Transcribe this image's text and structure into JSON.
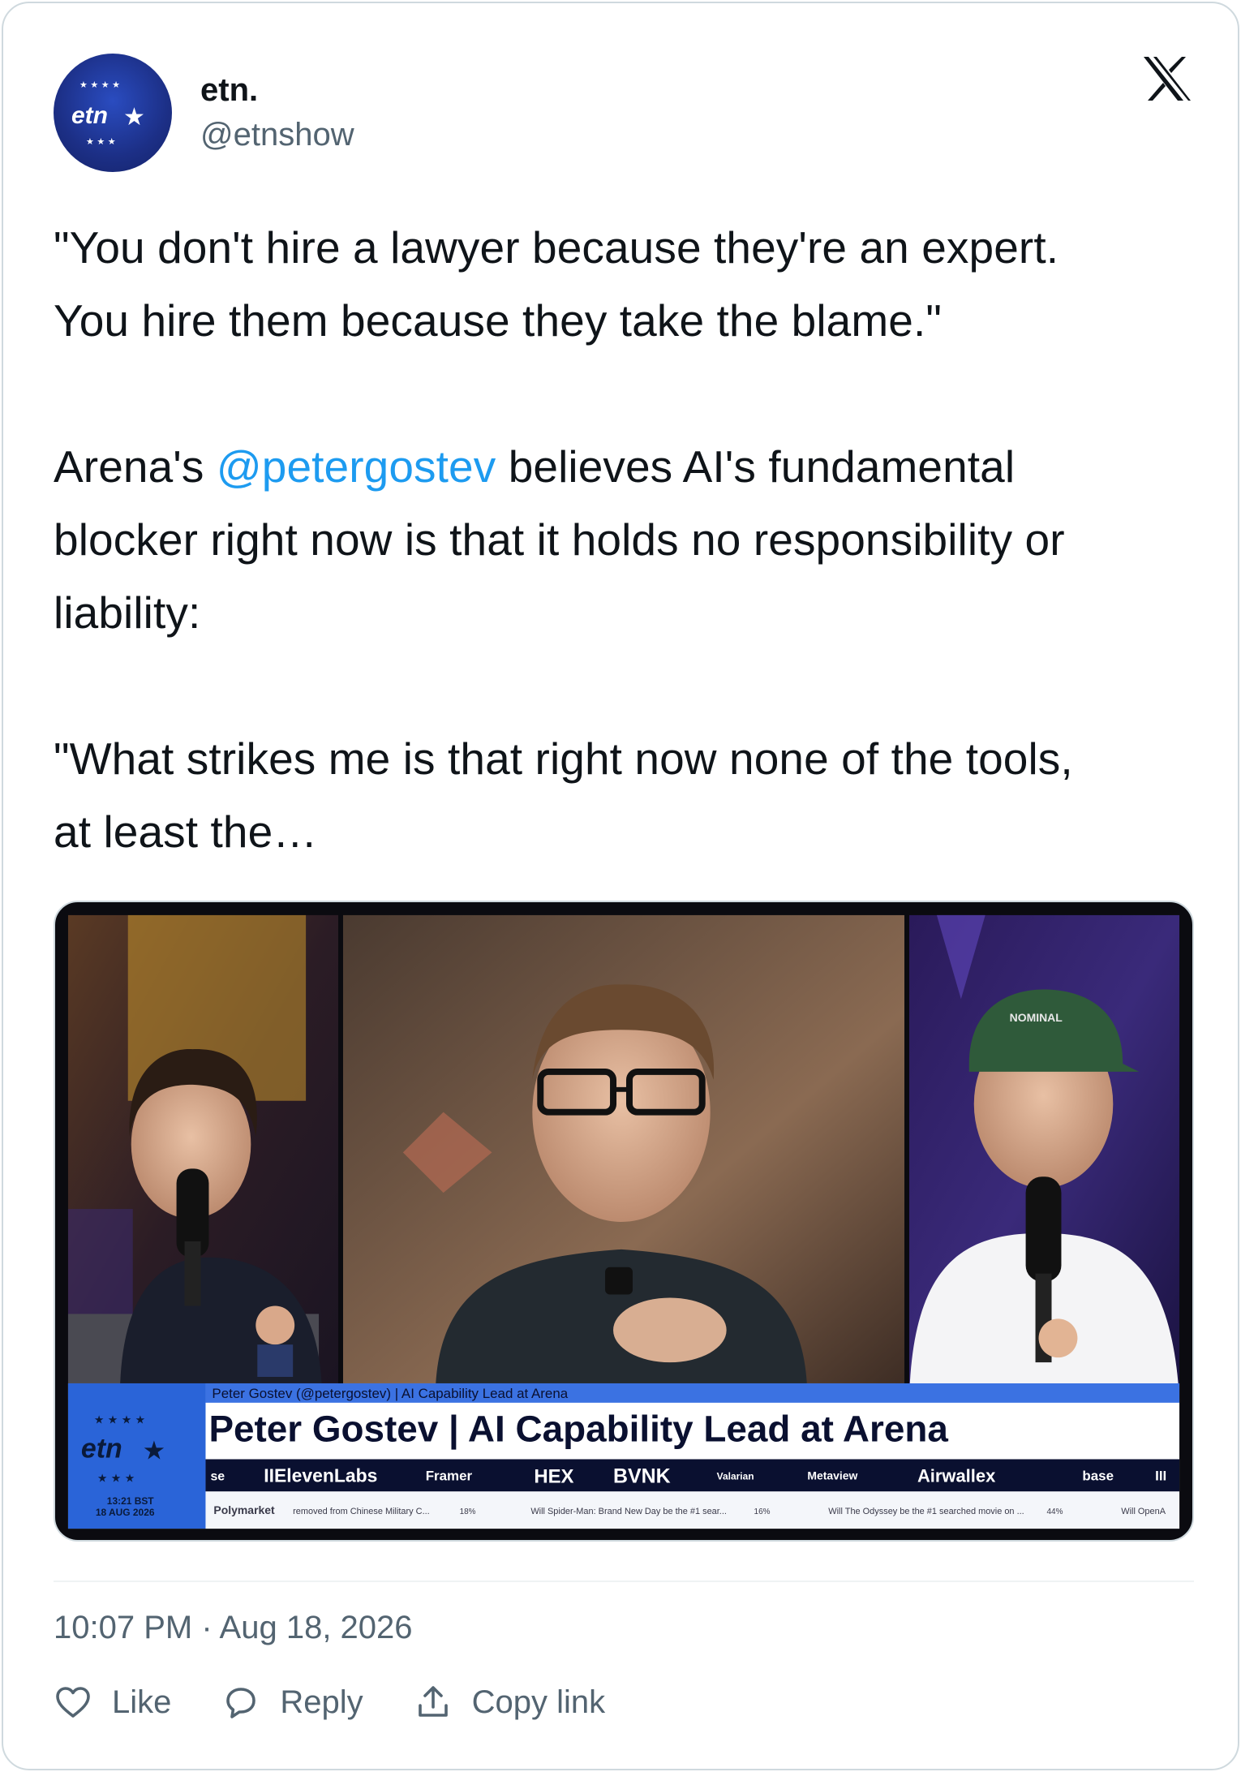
{
  "author": {
    "display_name": "etn.",
    "handle": "@etnshow",
    "avatar_text": "etn"
  },
  "icons": {
    "platform": "x-logo-icon",
    "like": "heart-icon",
    "reply": "speech-bubble-icon",
    "copy_link": "upload-icon"
  },
  "tweet": {
    "line1": "\"You don't hire a lawyer because they're an expert.",
    "line2": "You hire them because they take the blame.\"",
    "line3_pre": "Arena's ",
    "mention": "@petergostev",
    "line3_post": " believes AI's fundamental",
    "line4": "blocker right now is that it holds no responsibility or",
    "line5": "liability:",
    "line6": "\"What strikes me is that right now none of the tools,",
    "line7": "at least the…"
  },
  "media": {
    "lower_third_small": "Peter Gostev (@petergostev) | AI Capability Lead at Arena",
    "lower_third_title": "Peter Gostev | AI Capability Lead at Arena",
    "logo_text": "etn",
    "time": "13:21 BST",
    "date": "18 AUG 2026",
    "cap_text": "NOMINAL",
    "sponsors": [
      "se",
      "IIElevenLabs",
      "Framer",
      "HEX",
      "BVNK",
      "Valarian",
      "Metaview",
      "Airwallex",
      "base",
      "III"
    ],
    "ticker": {
      "source": "Polymarket",
      "items": [
        {
          "text": "removed from Chinese Military C...",
          "pct": "18%"
        },
        {
          "text": "Will Spider-Man: Brand New Day be the #1 sear...",
          "pct": "16%"
        },
        {
          "text": "Will The Odyssey be the #1 searched movie on ...",
          "pct": "44%"
        },
        {
          "text": "Will OpenA",
          "pct": ""
        }
      ]
    }
  },
  "footer": {
    "timestamp": "10:07 PM · Aug 18, 2026",
    "like_label": "Like",
    "reply_label": "Reply",
    "copy_label": "Copy link"
  }
}
